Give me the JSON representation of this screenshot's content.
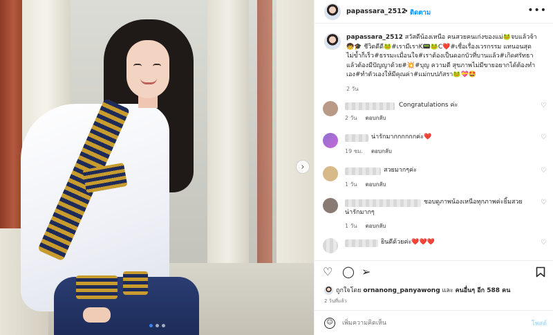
{
  "post": {
    "username": "papassara_2512",
    "follow_label": "ติดตาม",
    "separator": "•",
    "more_icon": "more-horizontal-icon",
    "carousel_next_icon": "chevron-right-icon",
    "slide_count": 3,
    "active_slide": 1
  },
  "caption": {
    "username": "papassara_2512",
    "line1": " สวัสดีน้องเหนือ คนสวยคนเก่งของแม่🐸จบแล้วจ้า",
    "line2": "🧒🎓 ชีวิตดีดี🐸#เรามีเราK📟🐸C❤️#เชื่อเรื่องเวรกรรม แทนอนสุด",
    "line3": "ไม่ข้ำก็เร็ว#ธรรมะเมื่อนใจ#เราต้องเป็นดอกบัวที่บานแล้ว#เกิดศรัทธา",
    "line4": "แล้วต้องมีปัญญาด้วย#💥#บุญ ความดี สุขภาพไม่มีขายอยากได้ต้องทำ",
    "line5": "เอง#ทำตัวเองให้มีคุณค่า#แม่กบปภัสรา🐸💝🤩",
    "time": "2 วัน"
  },
  "comments": [
    {
      "text": "Congratulations ค่ะ",
      "time": "2 วัน",
      "reply": "ตอบกลับ",
      "avatar_color": "#b89a86"
    },
    {
      "text": "น่ารักมากกกกกกค่ะ❤️",
      "time": "19 ชม.",
      "reply": "ตอบกลับ",
      "avatar_color": "#8f6fd1"
    },
    {
      "text": "สวยมากๆค่ะ",
      "time": "1 วัน",
      "reply": "ตอบกลับ",
      "avatar_color": "#d8b98a"
    },
    {
      "text": "ชอบดูภาพน้องเหนือทุกภาพค่ะยิ้มสวย",
      "text2": "น่ารักมากๆ",
      "time": "1 วัน",
      "reply": "ตอบกลับ",
      "avatar_color": "#8a7a74"
    },
    {
      "text": "ยินดีด้วยค่ะ❤️❤️❤️",
      "time": "",
      "reply": "",
      "avatar_color": "#d9d9d9"
    }
  ],
  "actions": {
    "like_icon": "heart-icon",
    "comment_icon": "comment-icon",
    "share_icon": "send-icon",
    "save_icon": "bookmark-icon"
  },
  "likes": {
    "prefix": "ถูกใจโดย",
    "user": "ornanong_panyawong",
    "middle": "และ",
    "others": "คนอื่นๆ อีก 588 คน"
  },
  "post_time": "2 วันที่แล้ว",
  "add_comment": {
    "placeholder": "เพิ่มความคิดเห็น",
    "post_label": "โพสต์",
    "emoji_icon": "emoji-icon"
  },
  "colors": {
    "accent": "#0095f6",
    "hashtag": "#00376b",
    "muted": "#737373",
    "post_disabled": "#b2dffc"
  }
}
